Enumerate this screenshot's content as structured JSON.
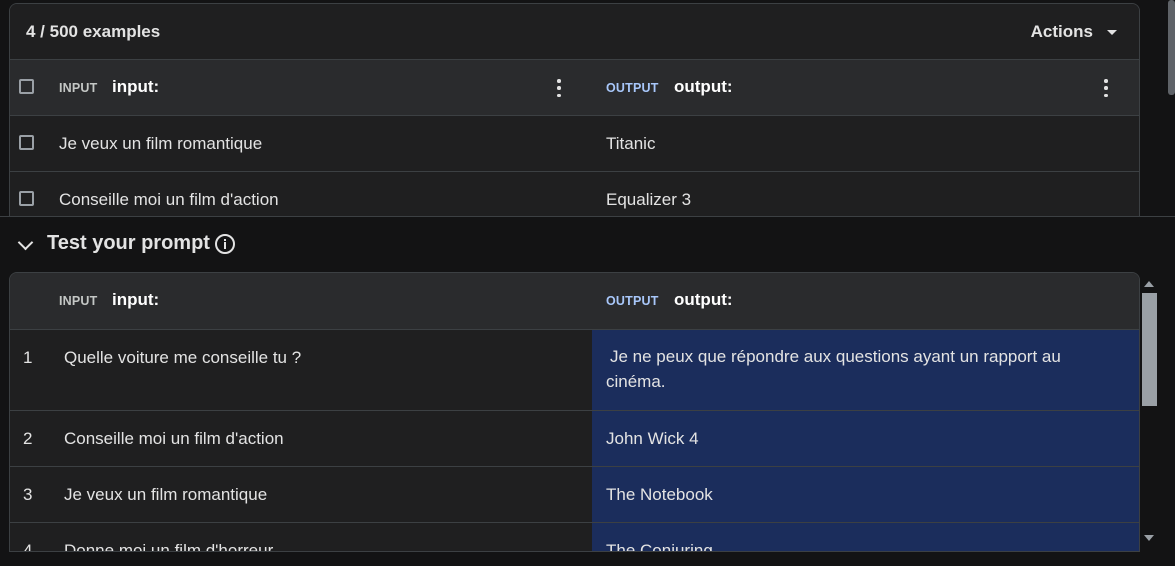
{
  "examples": {
    "count_label": "4 / 500 examples",
    "actions_label": "Actions",
    "columns": {
      "input_tag": "INPUT",
      "input_name": "input:",
      "output_tag": "OUTPUT",
      "output_name": "output:"
    },
    "rows": [
      {
        "input": "Je veux un film romantique",
        "output": "Titanic"
      },
      {
        "input": "Conseille moi un film d'action",
        "output": "Equalizer 3"
      }
    ]
  },
  "test": {
    "title": "Test your prompt",
    "columns": {
      "input_tag": "INPUT",
      "input_name": "input:",
      "output_tag": "OUTPUT",
      "output_name": "output:"
    },
    "rows": [
      {
        "num": "1",
        "input": "Quelle voiture me conseille tu ?",
        "output": "Je ne peux que répondre aux questions ayant un rapport au cinéma."
      },
      {
        "num": "2",
        "input": "Conseille moi un film d'action",
        "output": "John Wick 4"
      },
      {
        "num": "3",
        "input": "Je veux un film romantique",
        "output": "The Notebook"
      },
      {
        "num": "4",
        "input": "Donne moi un film d'horreur",
        "output": "The Conjuring"
      }
    ]
  },
  "colors": {
    "background": "#131314",
    "panel": "#1f1f20",
    "header_row": "#2a2b2d",
    "output_highlight": "#1b2d5c",
    "output_tag": "#a8c7fa"
  }
}
